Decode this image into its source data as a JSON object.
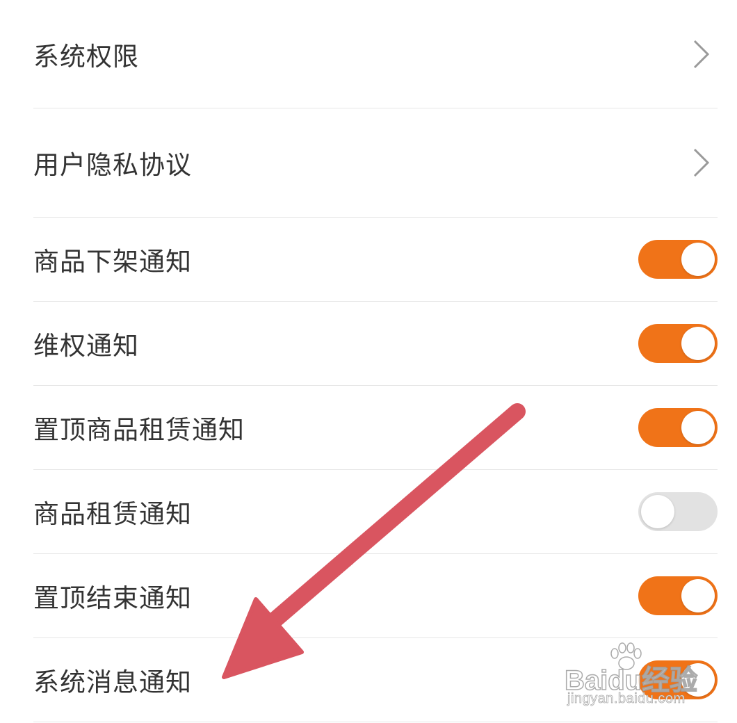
{
  "settings": {
    "items": [
      {
        "label": "系统权限",
        "control": "chevron"
      },
      {
        "label": "用户隐私协议",
        "control": "chevron"
      },
      {
        "label": "商品下架通知",
        "control": "toggle",
        "on": true
      },
      {
        "label": "维权通知",
        "control": "toggle",
        "on": true
      },
      {
        "label": "置顶商品租赁通知",
        "control": "toggle",
        "on": true
      },
      {
        "label": "商品租赁通知",
        "control": "toggle",
        "on": false
      },
      {
        "label": "置顶结束通知",
        "control": "toggle",
        "on": true
      },
      {
        "label": "系统消息通知",
        "control": "toggle",
        "on": true
      }
    ]
  },
  "colors": {
    "toggle_on": "#f07318",
    "toggle_off": "#e2e2e2",
    "arrow": "#d95560",
    "text": "#333333",
    "divider": "#e6e6e6"
  },
  "watermark": {
    "brand": "Baidu经验",
    "url": "jingyan.baidu.com"
  },
  "annotation": {
    "icon": "red-arrow-icon"
  }
}
